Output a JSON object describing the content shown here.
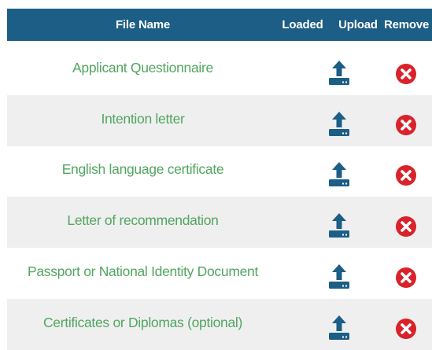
{
  "header": {
    "file_name": "File Name",
    "loaded": "Loaded",
    "upload": "Upload",
    "remove": "Remove"
  },
  "files": [
    {
      "name": "Applicant Questionnaire"
    },
    {
      "name": "Intention letter"
    },
    {
      "name": "English language certificate"
    },
    {
      "name": "Letter of recommendation"
    },
    {
      "name": "Passport or National Identity Document"
    },
    {
      "name": "Certificates or Diplomas (optional)"
    }
  ],
  "icons": {
    "upload": "upload-icon",
    "remove": "remove-icon"
  },
  "colors": {
    "header_bg": "#1c5e85",
    "header_text": "#ffffff",
    "file_name_text": "#52a560",
    "row_alt_bg": "#efefef",
    "upload_icon": "#1c5e85",
    "remove_icon": "#d9222a"
  }
}
